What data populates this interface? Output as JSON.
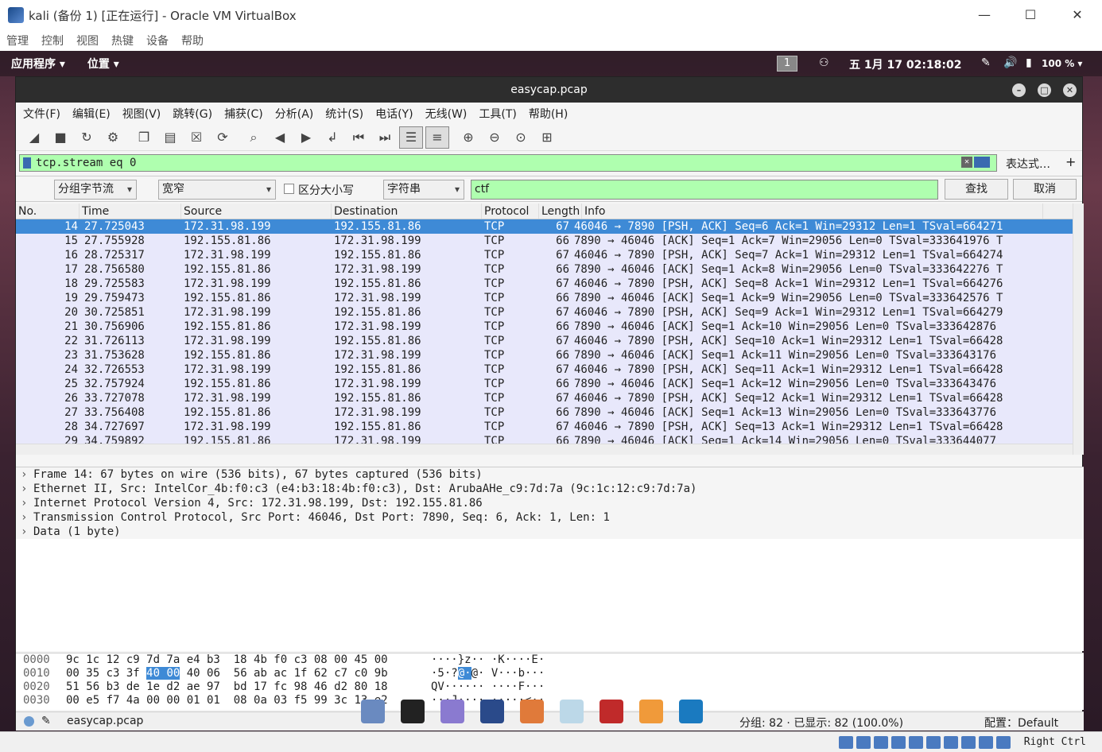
{
  "vbox": {
    "title": "kali (备份 1) [正在运行] - Oracle VM VirtualBox",
    "menu": [
      "管理",
      "控制",
      "视图",
      "热键",
      "设备",
      "帮助"
    ],
    "host_key": "Right Ctrl"
  },
  "desktop": {
    "apps_menu": "应用程序 ▾",
    "places_menu": "位置 ▾",
    "workspace": "1",
    "datetime": "五 1月 17  02:18:02",
    "battery": "100 % ▾"
  },
  "wireshark": {
    "title": "easycap.pcap",
    "menu": [
      "文件(F)",
      "编辑(E)",
      "视图(V)",
      "跳转(G)",
      "捕获(C)",
      "分析(A)",
      "统计(S)",
      "电话(Y)",
      "无线(W)",
      "工具(T)",
      "帮助(H)"
    ],
    "display_filter": "tcp.stream eq 0",
    "expression_label": "表达式…",
    "plus_label": "+",
    "find": {
      "search_in": "分组字节流",
      "charset": "宽窄",
      "case_label": "区分大小写",
      "type": "字符串",
      "query": "ctf",
      "find_button": "查找",
      "cancel_button": "取消"
    },
    "columns": [
      "No.",
      "Time",
      "Source",
      "Destination",
      "Protocol",
      "Length",
      "Info"
    ],
    "packets": [
      {
        "no": "14",
        "time": "27.725043",
        "src": "172.31.98.199",
        "dst": "192.155.81.86",
        "proto": "TCP",
        "len": "67",
        "info": "46046 → 7890 [PSH, ACK] Seq=6 Ack=1 Win=29312 Len=1 TSval=664271"
      },
      {
        "no": "15",
        "time": "27.755928",
        "src": "192.155.81.86",
        "dst": "172.31.98.199",
        "proto": "TCP",
        "len": "66",
        "info": "7890 → 46046 [ACK] Seq=1 Ack=7 Win=29056 Len=0 TSval=333641976 T"
      },
      {
        "no": "16",
        "time": "28.725317",
        "src": "172.31.98.199",
        "dst": "192.155.81.86",
        "proto": "TCP",
        "len": "67",
        "info": "46046 → 7890 [PSH, ACK] Seq=7 Ack=1 Win=29312 Len=1 TSval=664274"
      },
      {
        "no": "17",
        "time": "28.756580",
        "src": "192.155.81.86",
        "dst": "172.31.98.199",
        "proto": "TCP",
        "len": "66",
        "info": "7890 → 46046 [ACK] Seq=1 Ack=8 Win=29056 Len=0 TSval=333642276 T"
      },
      {
        "no": "18",
        "time": "29.725583",
        "src": "172.31.98.199",
        "dst": "192.155.81.86",
        "proto": "TCP",
        "len": "67",
        "info": "46046 → 7890 [PSH, ACK] Seq=8 Ack=1 Win=29312 Len=1 TSval=664276"
      },
      {
        "no": "19",
        "time": "29.759473",
        "src": "192.155.81.86",
        "dst": "172.31.98.199",
        "proto": "TCP",
        "len": "66",
        "info": "7890 → 46046 [ACK] Seq=1 Ack=9 Win=29056 Len=0 TSval=333642576 T"
      },
      {
        "no": "20",
        "time": "30.725851",
        "src": "172.31.98.199",
        "dst": "192.155.81.86",
        "proto": "TCP",
        "len": "67",
        "info": "46046 → 7890 [PSH, ACK] Seq=9 Ack=1 Win=29312 Len=1 TSval=664279"
      },
      {
        "no": "21",
        "time": "30.756906",
        "src": "192.155.81.86",
        "dst": "172.31.98.199",
        "proto": "TCP",
        "len": "66",
        "info": "7890 → 46046 [ACK] Seq=1 Ack=10 Win=29056 Len=0 TSval=333642876"
      },
      {
        "no": "22",
        "time": "31.726113",
        "src": "172.31.98.199",
        "dst": "192.155.81.86",
        "proto": "TCP",
        "len": "67",
        "info": "46046 → 7890 [PSH, ACK] Seq=10 Ack=1 Win=29312 Len=1 TSval=66428"
      },
      {
        "no": "23",
        "time": "31.753628",
        "src": "192.155.81.86",
        "dst": "172.31.98.199",
        "proto": "TCP",
        "len": "66",
        "info": "7890 → 46046 [ACK] Seq=1 Ack=11 Win=29056 Len=0 TSval=333643176"
      },
      {
        "no": "24",
        "time": "32.726553",
        "src": "172.31.98.199",
        "dst": "192.155.81.86",
        "proto": "TCP",
        "len": "67",
        "info": "46046 → 7890 [PSH, ACK] Seq=11 Ack=1 Win=29312 Len=1 TSval=66428"
      },
      {
        "no": "25",
        "time": "32.757924",
        "src": "192.155.81.86",
        "dst": "172.31.98.199",
        "proto": "TCP",
        "len": "66",
        "info": "7890 → 46046 [ACK] Seq=1 Ack=12 Win=29056 Len=0 TSval=333643476"
      },
      {
        "no": "26",
        "time": "33.727078",
        "src": "172.31.98.199",
        "dst": "192.155.81.86",
        "proto": "TCP",
        "len": "67",
        "info": "46046 → 7890 [PSH, ACK] Seq=12 Ack=1 Win=29312 Len=1 TSval=66428"
      },
      {
        "no": "27",
        "time": "33.756408",
        "src": "192.155.81.86",
        "dst": "172.31.98.199",
        "proto": "TCP",
        "len": "66",
        "info": "7890 → 46046 [ACK] Seq=1 Ack=13 Win=29056 Len=0 TSval=333643776"
      },
      {
        "no": "28",
        "time": "34.727697",
        "src": "172.31.98.199",
        "dst": "192.155.81.86",
        "proto": "TCP",
        "len": "67",
        "info": "46046 → 7890 [PSH, ACK] Seq=13 Ack=1 Win=29312 Len=1 TSval=66428"
      },
      {
        "no": "29",
        "time": "34.759892",
        "src": "192.155.81.86",
        "dst": "172.31.98.199",
        "proto": "TCP",
        "len": "66",
        "info": "7890 → 46046 [ACK] Seq=1 Ack=14 Win=29056 Len=0 TSval=333644077"
      }
    ],
    "details": [
      "Frame 14: 67 bytes on wire (536 bits), 67 bytes captured (536 bits)",
      "Ethernet II, Src: IntelCor_4b:f0:c3 (e4:b3:18:4b:f0:c3), Dst: ArubaAHe_c9:7d:7a (9c:1c:12:c9:7d:7a)",
      "Internet Protocol Version 4, Src: 172.31.98.199, Dst: 192.155.81.86",
      "Transmission Control Protocol, Src Port: 46046, Dst Port: 7890, Seq: 6, Ack: 1, Len: 1",
      "Data (1 byte)"
    ],
    "bytes": [
      {
        "off": "0000",
        "hex_a": "9c 1c 12 c9 7d 7a e4 b3",
        "hex_b": "18 4b f0 c3 08 00 45 00",
        "ascii": "····}z·· ·K····E·"
      },
      {
        "off": "0010",
        "hex_a": "00 35 c3 3f",
        "hex_hl": "40 00",
        "hex_a2": "40 06",
        "hex_b": "56 ab ac 1f 62 c7 c0 9b",
        "ascii_a": "·5·?",
        "ascii_hl": "@·",
        "ascii_b": "@· V···b···"
      },
      {
        "off": "0020",
        "hex_a": "51 56 b3 de 1e d2 ae 97",
        "hex_b": "bd 17 fc 98 46 d2 80 18",
        "ascii": "QV······ ····F···"
      },
      {
        "off": "0030",
        "hex_a": "00 e5 f7 4a 00 00 01 01",
        "hex_b": "08 0a 03 f5 99 3c 13 e2",
        "ascii": "···J···· ·····<··"
      }
    ],
    "status": {
      "file": "easycap.pcap",
      "packets": "分组: 82 · 已显示: 82 (100.0%)",
      "profile": "配置：Default"
    }
  }
}
